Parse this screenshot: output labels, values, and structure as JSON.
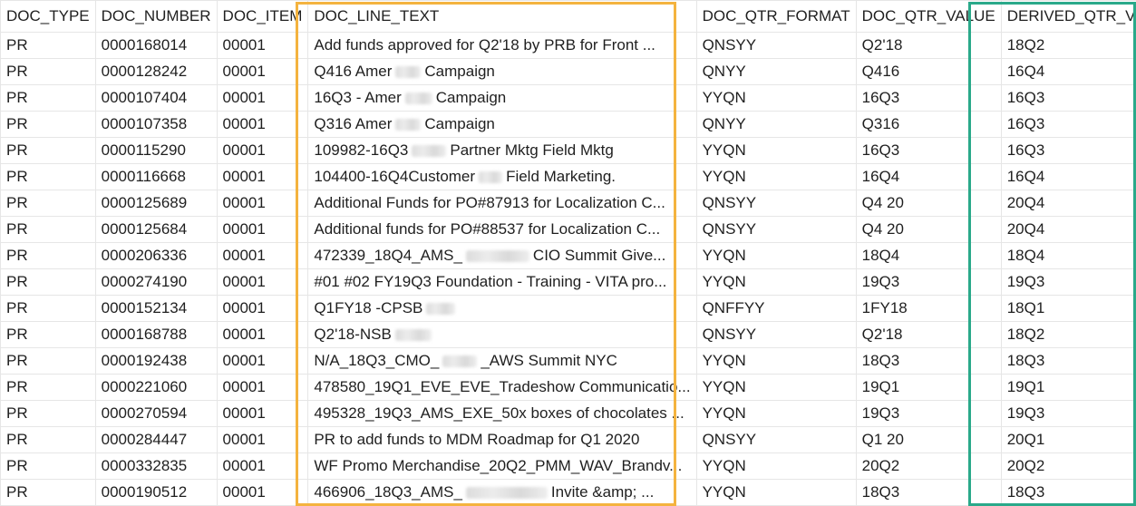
{
  "colors": {
    "highlight_text_col": "#f4b33f",
    "highlight_derived_col": "#2aa98a",
    "grid": "#e6e6e6"
  },
  "columns": [
    "DOC_TYPE",
    "DOC_NUMBER",
    "DOC_ITEM",
    "DOC_LINE_TEXT",
    "DOC_QTR_FORMAT",
    "DOC_QTR_VALUE",
    "DERIVED_QTR_VALUE"
  ],
  "rows": [
    {
      "type": "PR",
      "number": "0000168014",
      "item": "00001",
      "text_a": "Add funds approved for Q2'18 by PRB for Front ...",
      "text_b": "",
      "qfmt": "QNSYY",
      "qval": "Q2'18",
      "derived": "18Q2"
    },
    {
      "type": "PR",
      "number": "0000128242",
      "item": "00001",
      "text_a": " Q416 Amer",
      "text_b": "Campaign",
      "qfmt": "QNYY",
      "qval": "Q416",
      "derived": "16Q4"
    },
    {
      "type": "PR",
      "number": "0000107404",
      "item": "00001",
      "text_a": " 16Q3 - Amer",
      "text_b": "Campaign",
      "qfmt": "YYQN",
      "qval": "16Q3",
      "derived": "16Q3"
    },
    {
      "type": "PR",
      "number": "0000107358",
      "item": "00001",
      "text_a": " Q316 Amer",
      "text_b": "Campaign",
      "qfmt": "QNYY",
      "qval": "Q316",
      "derived": "16Q3"
    },
    {
      "type": "PR",
      "number": "0000115290",
      "item": "00001",
      "text_a": "109982-16Q3",
      "text_b": "Partner Mktg Field Mktg",
      "qfmt": "YYQN",
      "qval": "16Q3",
      "derived": "16Q3"
    },
    {
      "type": "PR",
      "number": "0000116668",
      "item": "00001",
      "text_a": "104400-16Q4Customer",
      "text_b": "Field Marketing.",
      "qfmt": "YYQN",
      "qval": "16Q4",
      "derived": "16Q4"
    },
    {
      "type": "PR",
      "number": "0000125689",
      "item": "00001",
      "text_a": "Additional Funds for PO#87913 for Localization C...",
      "text_b": "",
      "qfmt": "QNSYY",
      "qval": "Q4 20",
      "derived": "20Q4"
    },
    {
      "type": "PR",
      "number": "0000125684",
      "item": "00001",
      "text_a": "Additional funds for PO#88537 for Localization C...",
      "text_b": "",
      "qfmt": "QNSYY",
      "qval": "Q4 20",
      "derived": "20Q4"
    },
    {
      "type": "PR",
      "number": "0000206336",
      "item": "00001",
      "text_a": "472339_18Q4_AMS_",
      "text_b": "CIO Summit Give...",
      "qfmt": "YYQN",
      "qval": "18Q4",
      "derived": "18Q4"
    },
    {
      "type": "PR",
      "number": "0000274190",
      "item": "00001",
      "text_a": "#01 #02 FY19Q3 Foundation - Training - VITA pro...",
      "text_b": "",
      "qfmt": "YYQN",
      "qval": "19Q3",
      "derived": "19Q3"
    },
    {
      "type": "PR",
      "number": "0000152134",
      "item": "00001",
      "text_a": "Q1FY18 -CPSB",
      "text_b": "",
      "qfmt": "QNFFYY",
      "qval": "1FY18",
      "derived": "18Q1"
    },
    {
      "type": "PR",
      "number": "0000168788",
      "item": "00001",
      "text_a": " Q2'18-NSB",
      "text_b": "",
      "qfmt": "QNSYY",
      "qval": "Q2'18",
      "derived": "18Q2"
    },
    {
      "type": "PR",
      "number": "0000192438",
      "item": "00001",
      "text_a": "N/A_18Q3_CMO_",
      "text_b": "_AWS Summit NYC",
      "qfmt": "YYQN",
      "qval": "18Q3",
      "derived": "18Q3"
    },
    {
      "type": "PR",
      "number": "0000221060",
      "item": "00001",
      "text_a": "478580_19Q1_EVE_EVE_Tradeshow Communicatio...",
      "text_b": "",
      "qfmt": "YYQN",
      "qval": "19Q1",
      "derived": "19Q1"
    },
    {
      "type": "PR",
      "number": "0000270594",
      "item": "00001",
      "text_a": "495328_19Q3_AMS_EXE_50x boxes of chocolates ...",
      "text_b": "",
      "qfmt": "YYQN",
      "qval": "19Q3",
      "derived": "19Q3"
    },
    {
      "type": "PR",
      "number": "0000284447",
      "item": "00001",
      "text_a": "PR to add funds to MDM Roadmap for Q1 2020",
      "text_b": "",
      "qfmt": "QNSYY",
      "qval": "Q1 20",
      "derived": "20Q1"
    },
    {
      "type": "PR",
      "number": "0000332835",
      "item": "00001",
      "text_a": "WF Promo Merchandise_20Q2_PMM_WAV_Brandv...",
      "text_b": "",
      "qfmt": "YYQN",
      "qval": "20Q2",
      "derived": "20Q2"
    },
    {
      "type": "PR",
      "number": "0000190512",
      "item": "00001",
      "text_a": "466906_18Q3_AMS_",
      "text_b": "Invite &amp; ...",
      "qfmt": "YYQN",
      "qval": "18Q3",
      "derived": "18Q3"
    }
  ]
}
